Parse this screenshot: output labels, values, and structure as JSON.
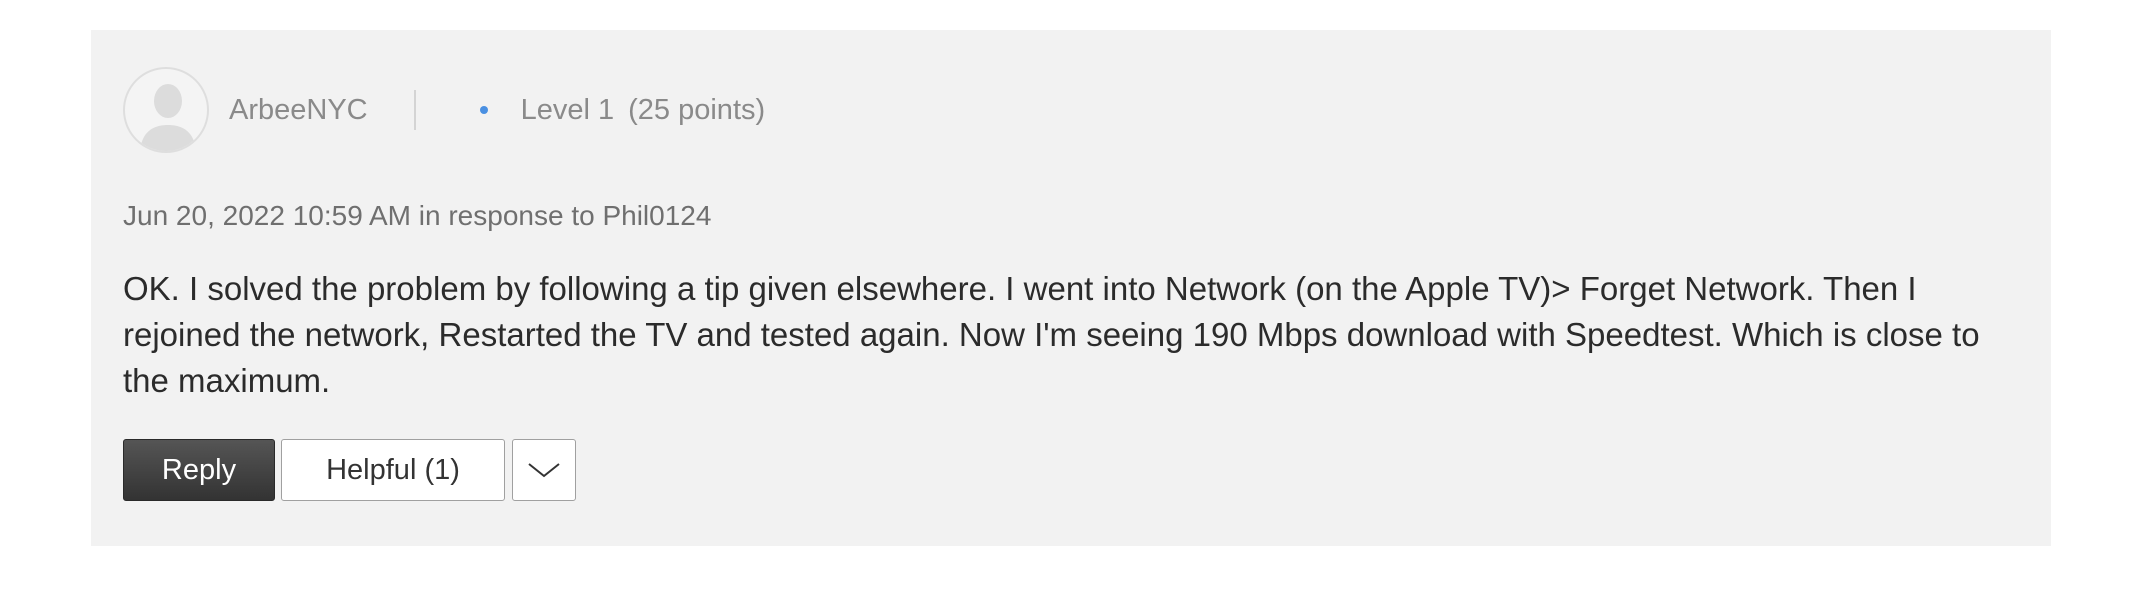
{
  "post": {
    "author": {
      "username": "ArbeeNYC",
      "level": "Level 1",
      "points": "(25 points)",
      "avatar_icon": "default-user-icon"
    },
    "meta": {
      "timestamp_line": "Jun 20, 2022 10:59 AM in response to Phil0124"
    },
    "body": "OK. I solved the problem by following a tip given elsewhere. I went into Network (on the Apple TV)> Forget Network. Then I rejoined the network, Restarted the TV and tested again. Now I'm seeing 190 Mbps download with Speedtest. Which is close to the maximum.",
    "actions": {
      "reply_label": "Reply",
      "helpful_label": "Helpful (1)",
      "more_icon": "chevron-down-icon"
    }
  },
  "colors": {
    "card_background": "#f2f2f2",
    "level_dot": "#4a90e2",
    "reply_button": "#3c3c3c",
    "secondary_text": "#8a8a8a"
  }
}
